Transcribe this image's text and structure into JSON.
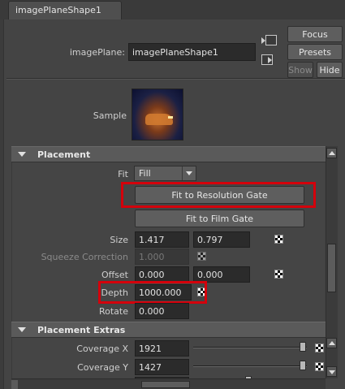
{
  "tab": {
    "label": "imagePlaneShape1"
  },
  "header": {
    "imageplane_label": "imagePlane:",
    "imageplane_value": "imagePlaneShape1",
    "focus_label": "Focus",
    "presets_label": "Presets",
    "show_label": "Show",
    "hide_label": "Hide"
  },
  "sample": {
    "label": "Sample"
  },
  "placement": {
    "title": "Placement",
    "fit_label": "Fit",
    "fit_value": "Fill",
    "fit_resolution_gate": "Fit to Resolution Gate",
    "fit_film_gate": "Fit to Film Gate",
    "size_label": "Size",
    "size_x": "1.417",
    "size_y": "0.797",
    "squeeze_label": "Squeeze Correction",
    "squeeze_value": "1.000",
    "offset_label": "Offset",
    "offset_x": "0.000",
    "offset_y": "0.000",
    "depth_label": "Depth",
    "depth_value": "1000.000",
    "rotate_label": "Rotate",
    "rotate_value": "0.000"
  },
  "placement_extras": {
    "title": "Placement Extras",
    "coverage_x_label": "Coverage X",
    "coverage_x_value": "1921",
    "coverage_x_level": 0.99,
    "coverage_y_label": "Coverage Y",
    "coverage_y_value": "1427",
    "coverage_y_level": 0.99
  },
  "colors": {
    "highlight": "#d4000b",
    "panel_bg": "#444444",
    "field_bg": "#2b2b2b"
  },
  "icons": [
    "nav-in-icon",
    "nav-out-icon",
    "collapse-triangle-icon",
    "checker-map-icon",
    "scroll-up-icon",
    "scroll-down-icon"
  ]
}
